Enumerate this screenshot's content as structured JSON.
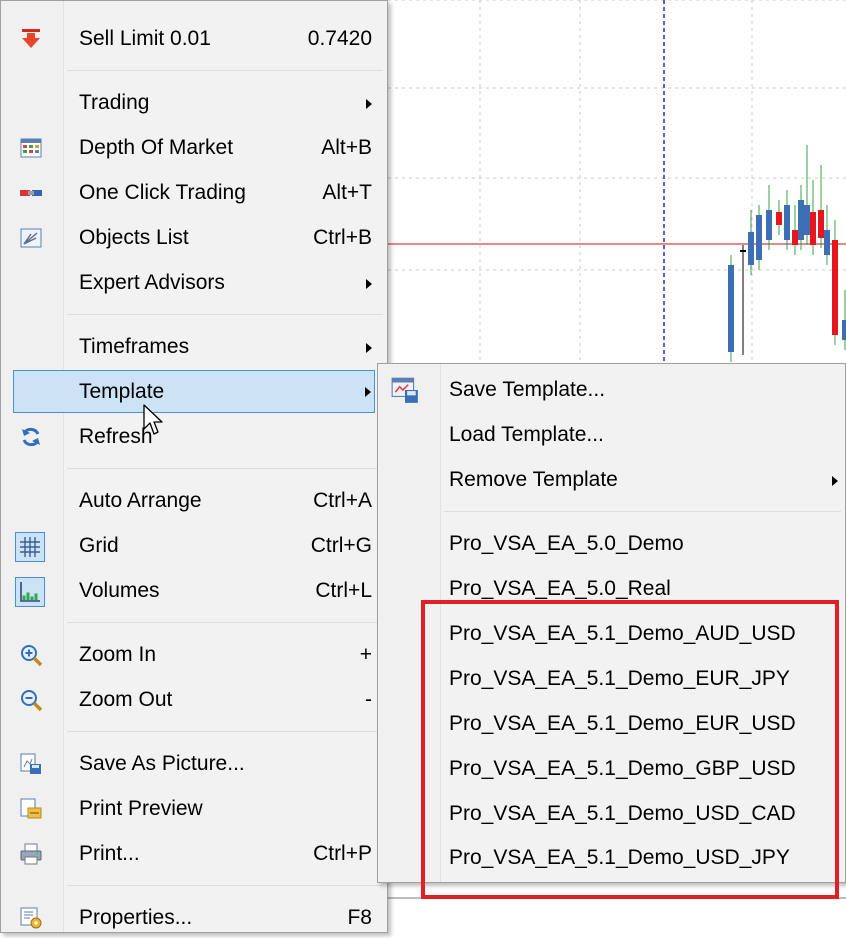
{
  "main_menu": {
    "items": [
      {
        "id": "sell-limit",
        "icon": "down-arrow-icon",
        "label": "Sell Limit 0.01",
        "shortcut": "0.7420"
      },
      {
        "id": "trading",
        "label": "Trading",
        "submenu": true
      },
      {
        "id": "depth-of-market",
        "icon": "depth-of-market-icon",
        "label": "Depth Of Market",
        "shortcut": "Alt+B"
      },
      {
        "id": "one-click-trading",
        "icon": "one-click-trading-icon",
        "label": "One Click Trading",
        "shortcut": "Alt+T"
      },
      {
        "id": "objects-list",
        "icon": "objects-list-icon",
        "label": "Objects List",
        "shortcut": "Ctrl+B"
      },
      {
        "id": "expert-advisors",
        "label": "Expert Advisors",
        "submenu": true
      },
      {
        "id": "timeframes",
        "label": "Timeframes",
        "submenu": true
      },
      {
        "id": "template",
        "label": "Template",
        "submenu": true,
        "highlighted": true
      },
      {
        "id": "refresh",
        "icon": "refresh-icon",
        "label": "Refresh"
      },
      {
        "id": "auto-arrange",
        "label": "Auto Arrange",
        "shortcut": "Ctrl+A"
      },
      {
        "id": "grid",
        "icon": "grid-icon",
        "label": "Grid",
        "shortcut": "Ctrl+G",
        "checked": true
      },
      {
        "id": "volumes",
        "icon": "volumes-icon",
        "label": "Volumes",
        "shortcut": "Ctrl+L",
        "checked": true
      },
      {
        "id": "zoom-in",
        "icon": "zoom-in-icon",
        "label": "Zoom In",
        "shortcut": "+"
      },
      {
        "id": "zoom-out",
        "icon": "zoom-out-icon",
        "label": "Zoom Out",
        "shortcut": "-"
      },
      {
        "id": "save-as-picture",
        "icon": "save-picture-icon",
        "label": "Save As Picture..."
      },
      {
        "id": "print-preview",
        "icon": "print-preview-icon",
        "label": "Print Preview"
      },
      {
        "id": "print",
        "icon": "printer-icon",
        "label": "Print...",
        "shortcut": "Ctrl+P"
      },
      {
        "id": "properties",
        "icon": "properties-icon",
        "label": "Properties...",
        "shortcut": "F8"
      }
    ]
  },
  "template_submenu": {
    "items": [
      {
        "id": "save-template",
        "icon": "save-template-icon",
        "label": "Save Template..."
      },
      {
        "id": "load-template",
        "label": "Load Template..."
      },
      {
        "id": "remove-template",
        "label": "Remove Template",
        "submenu": true
      },
      {
        "id": "tpl-1",
        "label": "Pro_VSA_EA_5.0_Demo"
      },
      {
        "id": "tpl-2",
        "label": "Pro_VSA_EA_5.0_Real"
      },
      {
        "id": "tpl-3",
        "label": "Pro_VSA_EA_5.1_Demo_AUD_USD"
      },
      {
        "id": "tpl-4",
        "label": "Pro_VSA_EA_5.1_Demo_EUR_JPY"
      },
      {
        "id": "tpl-5",
        "label": "Pro_VSA_EA_5.1_Demo_EUR_USD"
      },
      {
        "id": "tpl-6",
        "label": "Pro_VSA_EA_5.1_Demo_GBP_USD"
      },
      {
        "id": "tpl-7",
        "label": "Pro_VSA_EA_5.1_Demo_USD_CAD"
      },
      {
        "id": "tpl-8",
        "label": "Pro_VSA_EA_5.1_Demo_USD_JPY"
      }
    ]
  },
  "colors": {
    "highlight_box": "#e01f26",
    "menu_highlight": "#cce3f6",
    "bull_candle": "#3d6fb4",
    "bear_candle": "#e5161d",
    "price_line": "#d94040",
    "period_separator": "#1e2fbf"
  }
}
